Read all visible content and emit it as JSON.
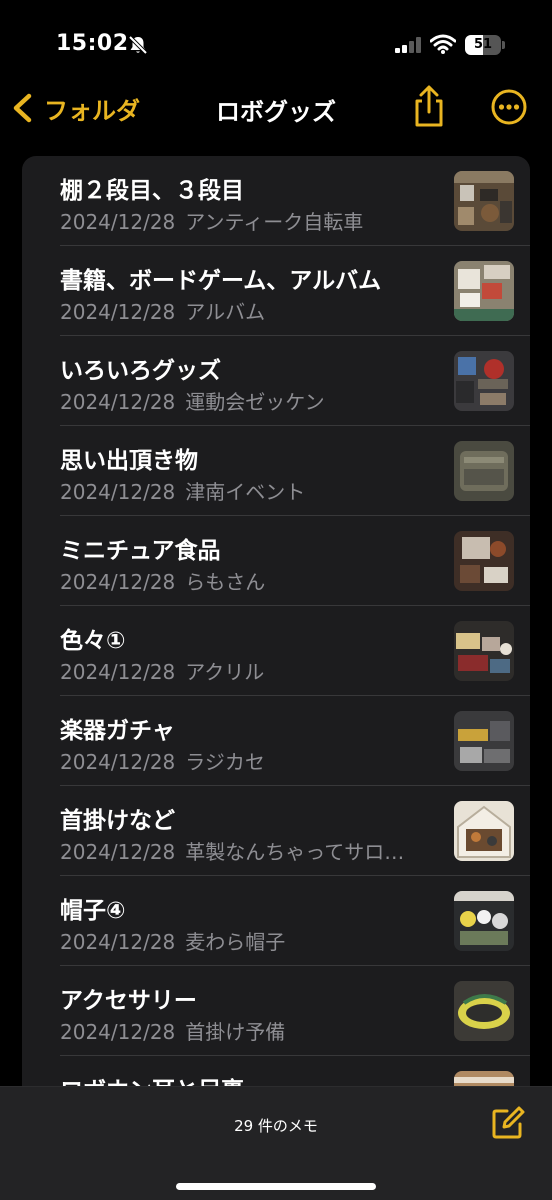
{
  "status_bar": {
    "time": "15:02",
    "battery_level": "51",
    "icons": [
      "bell-slash-icon",
      "cellular-signal-icon",
      "wifi-icon",
      "battery-icon"
    ]
  },
  "nav": {
    "back_label": "フォルダ",
    "title": "ロボグッズ",
    "share_icon": "share-icon",
    "more_icon": "ellipsis-circle-icon"
  },
  "colors": {
    "accent": "#E9B521",
    "background": "#000000",
    "list_background": "#1C1C1E",
    "secondary_text": "#8E8E93"
  },
  "notes": [
    {
      "title": "棚２段目、３段目",
      "date": "2024/12/28",
      "preview": "アンティーク自転車"
    },
    {
      "title": "書籍、ボードゲーム、アルバム",
      "date": "2024/12/28",
      "preview": "アルバム"
    },
    {
      "title": "いろいろグッズ",
      "date": "2024/12/28",
      "preview": "運動会ゼッケン"
    },
    {
      "title": "思い出頂き物",
      "date": "2024/12/28",
      "preview": "津南イベント"
    },
    {
      "title": "ミニチュア食品",
      "date": "2024/12/28",
      "preview": "らもさん"
    },
    {
      "title": "色々①",
      "date": "2024/12/28",
      "preview": "アクリル"
    },
    {
      "title": "楽器ガチャ",
      "date": "2024/12/28",
      "preview": "ラジカセ"
    },
    {
      "title": "首掛けなど",
      "date": "2024/12/28",
      "preview": "革製なんちゃってサロ…"
    },
    {
      "title": "帽子④",
      "date": "2024/12/28",
      "preview": "麦わら帽子"
    },
    {
      "title": "アクセサリー",
      "date": "2024/12/28",
      "preview": "首掛け予備"
    },
    {
      "title": "ロボホン耳と足裏",
      "date": "",
      "preview": ""
    }
  ],
  "toolbar": {
    "count_label": "29 件のメモ",
    "compose_icon": "compose-icon"
  }
}
